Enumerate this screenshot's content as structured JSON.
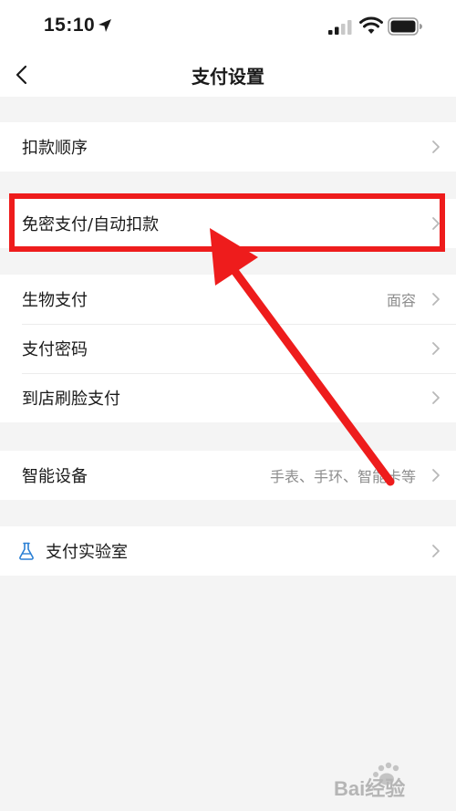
{
  "status_bar": {
    "time": "15:10"
  },
  "nav": {
    "title": "支付设置"
  },
  "groups": [
    {
      "items": [
        {
          "label": "扣款顺序",
          "value": ""
        }
      ]
    },
    {
      "items": [
        {
          "label": "免密支付/自动扣款",
          "value": ""
        }
      ]
    },
    {
      "items": [
        {
          "label": "生物支付",
          "value": "面容"
        },
        {
          "label": "支付密码",
          "value": ""
        },
        {
          "label": "到店刷脸支付",
          "value": ""
        }
      ]
    },
    {
      "items": [
        {
          "label": "智能设备",
          "value": "手表、手环、智能卡等"
        }
      ]
    },
    {
      "items": [
        {
          "label": "支付实验室",
          "value": "",
          "icon": "flask-icon"
        }
      ]
    }
  ],
  "colors": {
    "accent_annotation": "#ee1c1c",
    "icon_blue": "#2a7fd4",
    "background": "#f4f4f4"
  },
  "watermark": {
    "text": "Bai经验"
  }
}
